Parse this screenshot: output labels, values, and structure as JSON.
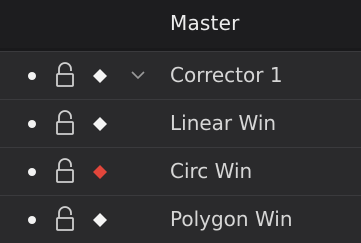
{
  "header": {
    "title": "Master"
  },
  "colors": {
    "background": "#19191b",
    "row": "#2a2a2c",
    "text": "#d6d6d6",
    "keyframe_white": "#f4f4f4",
    "keyframe_red": "#e2463b"
  },
  "nodes": [
    {
      "label": "Corrector 1",
      "keyframe_color": "white",
      "icons": [
        "visibility-dot-icon",
        "lock-icon",
        "keyframe-diamond-icon",
        "chevron-down-icon"
      ]
    },
    {
      "label": "Linear Win",
      "keyframe_color": "white",
      "icons": [
        "visibility-dot-icon",
        "lock-icon",
        "keyframe-diamond-icon"
      ]
    },
    {
      "label": "Circ Win",
      "keyframe_color": "red",
      "icons": [
        "visibility-dot-icon",
        "lock-icon",
        "keyframe-diamond-icon"
      ]
    },
    {
      "label": "Polygon Win",
      "keyframe_color": "white",
      "icons": [
        "visibility-dot-icon",
        "lock-icon",
        "keyframe-diamond-icon"
      ]
    }
  ]
}
